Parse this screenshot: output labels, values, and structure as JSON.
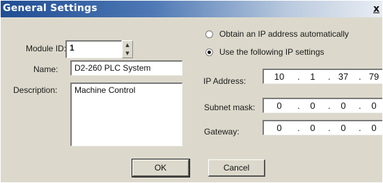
{
  "window": {
    "title": "General Settings",
    "close_glyph": "x"
  },
  "module_id": {
    "label": "Module ID:",
    "value": "1"
  },
  "name": {
    "label": "Name:",
    "value": "D2-260 PLC System"
  },
  "description": {
    "label": "Description:",
    "value": "Machine Control"
  },
  "ip_mode": {
    "auto_label": "Obtain an IP address automatically",
    "manual_label": "Use the following IP settings",
    "selected": "manual"
  },
  "ip_address": {
    "label": "IP Address:",
    "octets": [
      "10",
      "1",
      "37",
      "79"
    ]
  },
  "subnet_mask": {
    "label": "Subnet mask:",
    "octets": [
      "0",
      "0",
      "0",
      "0"
    ]
  },
  "gateway": {
    "label": "Gateway:",
    "octets": [
      "0",
      "0",
      "0",
      "0"
    ]
  },
  "buttons": {
    "ok": "OK",
    "cancel": "Cancel"
  }
}
